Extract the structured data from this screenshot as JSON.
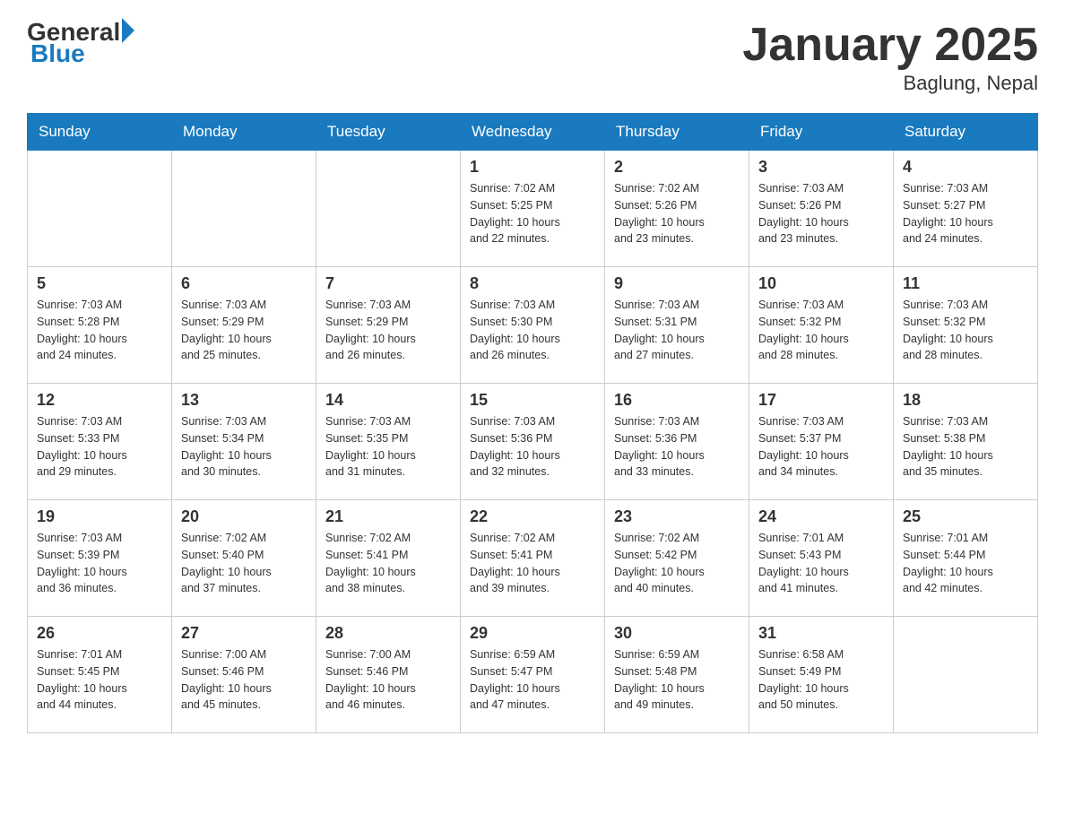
{
  "header": {
    "logo_general": "General",
    "logo_blue": "Blue",
    "title": "January 2025",
    "subtitle": "Baglung, Nepal"
  },
  "weekdays": [
    "Sunday",
    "Monday",
    "Tuesday",
    "Wednesday",
    "Thursday",
    "Friday",
    "Saturday"
  ],
  "weeks": [
    [
      {
        "day": "",
        "info": ""
      },
      {
        "day": "",
        "info": ""
      },
      {
        "day": "",
        "info": ""
      },
      {
        "day": "1",
        "info": "Sunrise: 7:02 AM\nSunset: 5:25 PM\nDaylight: 10 hours\nand 22 minutes."
      },
      {
        "day": "2",
        "info": "Sunrise: 7:02 AM\nSunset: 5:26 PM\nDaylight: 10 hours\nand 23 minutes."
      },
      {
        "day": "3",
        "info": "Sunrise: 7:03 AM\nSunset: 5:26 PM\nDaylight: 10 hours\nand 23 minutes."
      },
      {
        "day": "4",
        "info": "Sunrise: 7:03 AM\nSunset: 5:27 PM\nDaylight: 10 hours\nand 24 minutes."
      }
    ],
    [
      {
        "day": "5",
        "info": "Sunrise: 7:03 AM\nSunset: 5:28 PM\nDaylight: 10 hours\nand 24 minutes."
      },
      {
        "day": "6",
        "info": "Sunrise: 7:03 AM\nSunset: 5:29 PM\nDaylight: 10 hours\nand 25 minutes."
      },
      {
        "day": "7",
        "info": "Sunrise: 7:03 AM\nSunset: 5:29 PM\nDaylight: 10 hours\nand 26 minutes."
      },
      {
        "day": "8",
        "info": "Sunrise: 7:03 AM\nSunset: 5:30 PM\nDaylight: 10 hours\nand 26 minutes."
      },
      {
        "day": "9",
        "info": "Sunrise: 7:03 AM\nSunset: 5:31 PM\nDaylight: 10 hours\nand 27 minutes."
      },
      {
        "day": "10",
        "info": "Sunrise: 7:03 AM\nSunset: 5:32 PM\nDaylight: 10 hours\nand 28 minutes."
      },
      {
        "day": "11",
        "info": "Sunrise: 7:03 AM\nSunset: 5:32 PM\nDaylight: 10 hours\nand 28 minutes."
      }
    ],
    [
      {
        "day": "12",
        "info": "Sunrise: 7:03 AM\nSunset: 5:33 PM\nDaylight: 10 hours\nand 29 minutes."
      },
      {
        "day": "13",
        "info": "Sunrise: 7:03 AM\nSunset: 5:34 PM\nDaylight: 10 hours\nand 30 minutes."
      },
      {
        "day": "14",
        "info": "Sunrise: 7:03 AM\nSunset: 5:35 PM\nDaylight: 10 hours\nand 31 minutes."
      },
      {
        "day": "15",
        "info": "Sunrise: 7:03 AM\nSunset: 5:36 PM\nDaylight: 10 hours\nand 32 minutes."
      },
      {
        "day": "16",
        "info": "Sunrise: 7:03 AM\nSunset: 5:36 PM\nDaylight: 10 hours\nand 33 minutes."
      },
      {
        "day": "17",
        "info": "Sunrise: 7:03 AM\nSunset: 5:37 PM\nDaylight: 10 hours\nand 34 minutes."
      },
      {
        "day": "18",
        "info": "Sunrise: 7:03 AM\nSunset: 5:38 PM\nDaylight: 10 hours\nand 35 minutes."
      }
    ],
    [
      {
        "day": "19",
        "info": "Sunrise: 7:03 AM\nSunset: 5:39 PM\nDaylight: 10 hours\nand 36 minutes."
      },
      {
        "day": "20",
        "info": "Sunrise: 7:02 AM\nSunset: 5:40 PM\nDaylight: 10 hours\nand 37 minutes."
      },
      {
        "day": "21",
        "info": "Sunrise: 7:02 AM\nSunset: 5:41 PM\nDaylight: 10 hours\nand 38 minutes."
      },
      {
        "day": "22",
        "info": "Sunrise: 7:02 AM\nSunset: 5:41 PM\nDaylight: 10 hours\nand 39 minutes."
      },
      {
        "day": "23",
        "info": "Sunrise: 7:02 AM\nSunset: 5:42 PM\nDaylight: 10 hours\nand 40 minutes."
      },
      {
        "day": "24",
        "info": "Sunrise: 7:01 AM\nSunset: 5:43 PM\nDaylight: 10 hours\nand 41 minutes."
      },
      {
        "day": "25",
        "info": "Sunrise: 7:01 AM\nSunset: 5:44 PM\nDaylight: 10 hours\nand 42 minutes."
      }
    ],
    [
      {
        "day": "26",
        "info": "Sunrise: 7:01 AM\nSunset: 5:45 PM\nDaylight: 10 hours\nand 44 minutes."
      },
      {
        "day": "27",
        "info": "Sunrise: 7:00 AM\nSunset: 5:46 PM\nDaylight: 10 hours\nand 45 minutes."
      },
      {
        "day": "28",
        "info": "Sunrise: 7:00 AM\nSunset: 5:46 PM\nDaylight: 10 hours\nand 46 minutes."
      },
      {
        "day": "29",
        "info": "Sunrise: 6:59 AM\nSunset: 5:47 PM\nDaylight: 10 hours\nand 47 minutes."
      },
      {
        "day": "30",
        "info": "Sunrise: 6:59 AM\nSunset: 5:48 PM\nDaylight: 10 hours\nand 49 minutes."
      },
      {
        "day": "31",
        "info": "Sunrise: 6:58 AM\nSunset: 5:49 PM\nDaylight: 10 hours\nand 50 minutes."
      },
      {
        "day": "",
        "info": ""
      }
    ]
  ]
}
